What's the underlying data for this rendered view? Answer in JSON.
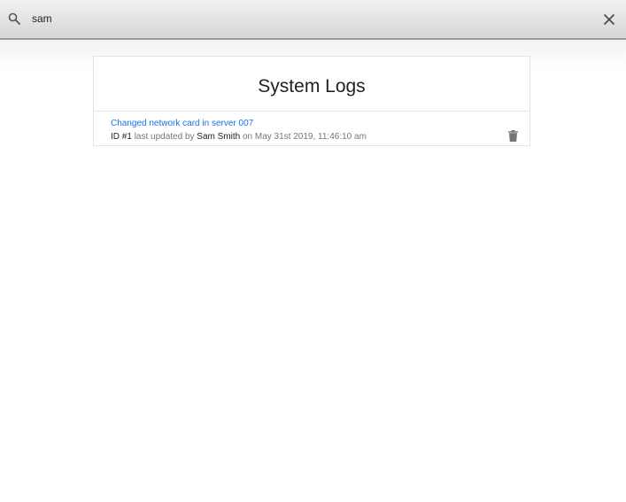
{
  "search": {
    "value": "sam",
    "icon": "search-icon",
    "clear_icon": "close-icon"
  },
  "page": {
    "title": "System Logs"
  },
  "logs": [
    {
      "title": "Changed network card in server 007",
      "id_label": "ID",
      "id_value": "#1",
      "updated_by_text": "last updated by",
      "user": "Sam Smith",
      "on_text": "on",
      "timestamp": "May 31st 2019, 11:46:10 am",
      "delete_icon": "trash-icon"
    }
  ],
  "colors": {
    "link": "#1a73e8",
    "meta_text": "#777777",
    "title_text": "#222222",
    "icon": "#757575"
  }
}
